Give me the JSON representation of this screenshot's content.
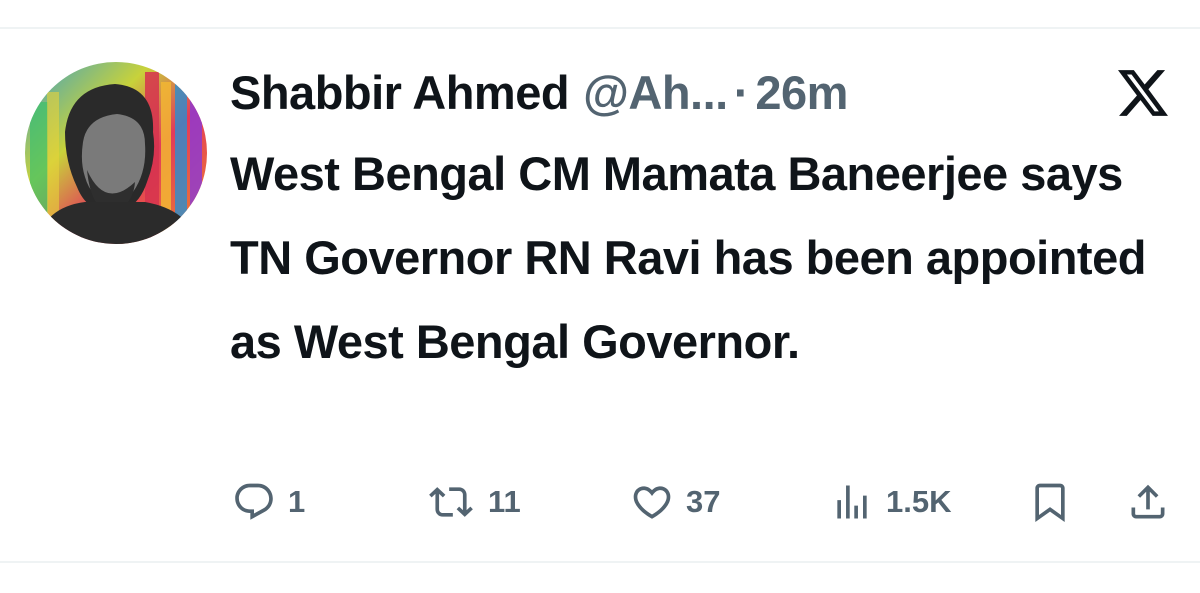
{
  "tweet": {
    "author": {
      "display_name": "Shabbir Ahmed",
      "handle": "@Ah..."
    },
    "separator": "·",
    "timestamp": "26m",
    "text": "West Bengal CM Mamata Baneerjee says TN Governor RN Ravi has been appointed as West Bengal Governor.",
    "platform_icon": "x-logo-icon"
  },
  "actions": {
    "reply": {
      "icon": "reply-icon",
      "count": "1"
    },
    "retweet": {
      "icon": "retweet-icon",
      "count": "11"
    },
    "like": {
      "icon": "heart-icon",
      "count": "37"
    },
    "views": {
      "icon": "views-icon",
      "count": "1.5K"
    },
    "bookmark": {
      "icon": "bookmark-icon"
    },
    "share": {
      "icon": "share-icon"
    }
  },
  "colors": {
    "text_primary": "#0f1419",
    "text_secondary": "#536471",
    "divider": "#eff3f4"
  }
}
